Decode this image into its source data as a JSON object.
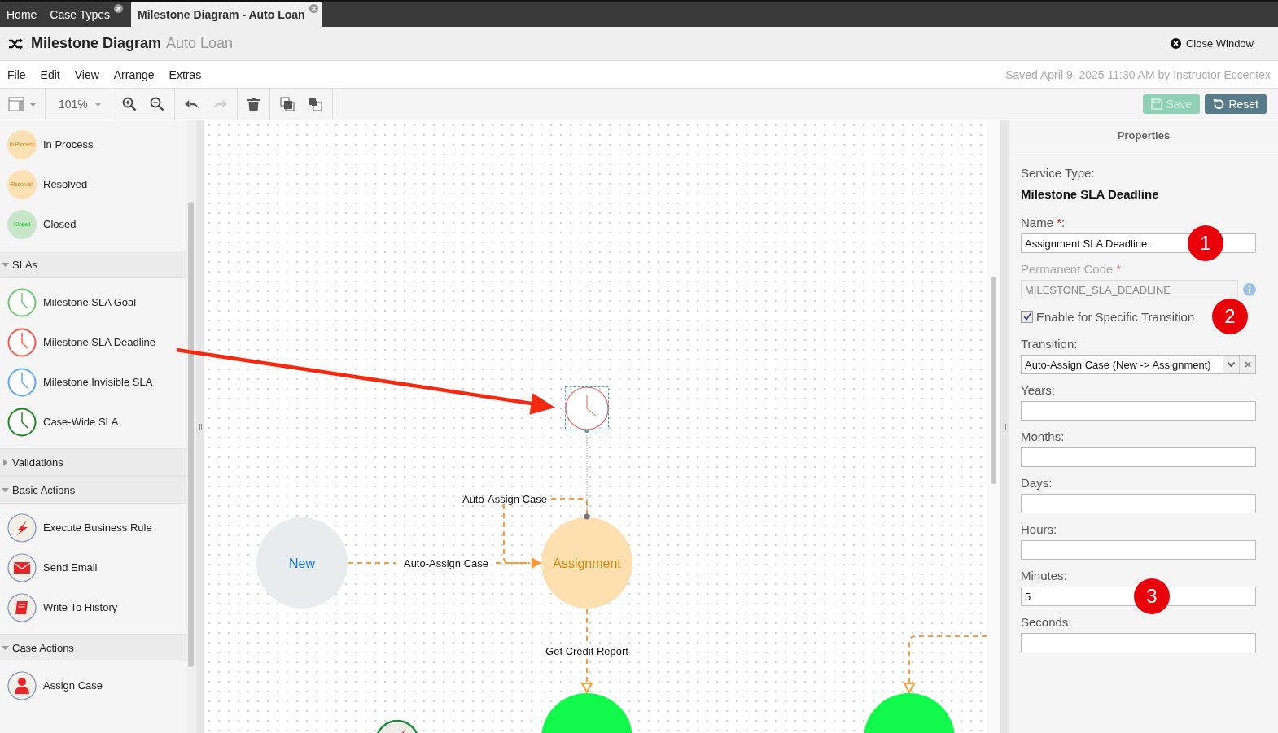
{
  "tabs": [
    {
      "label": "Home",
      "selected": false,
      "closable": false
    },
    {
      "label": "Case Types",
      "selected": false,
      "closable": true
    },
    {
      "label": "Milestone Diagram - Auto Loan",
      "selected": true,
      "closable": true
    }
  ],
  "header": {
    "title": "Milestone Diagram",
    "subtitle": "Auto Loan",
    "close_label": "Close Window"
  },
  "menu": [
    "File",
    "Edit",
    "View",
    "Arrange",
    "Extras"
  ],
  "saved_status": "Saved April 9, 2025 11:30 AM by Instructor Eccentex",
  "toolbar": {
    "zoom": "101%",
    "save": {
      "label": "Save",
      "disabled": true
    },
    "reset": "Reset"
  },
  "palette": [
    {
      "items": [
        {
          "kind": "state",
          "label": "In Process",
          "badge_text": "In Process",
          "color": "#fde0b4"
        },
        {
          "kind": "state",
          "label": "Resolved",
          "badge_text": "Resolved",
          "color": "#fde0b4"
        },
        {
          "kind": "state",
          "label": "Closed",
          "badge_text": "Closed",
          "color": "#c8e6c9"
        }
      ]
    },
    {
      "title": "SLAs",
      "expanded": true,
      "items": [
        {
          "kind": "sla",
          "label": "Milestone SLA Goal",
          "color": "#6cc86c"
        },
        {
          "kind": "sla",
          "label": "Milestone SLA Deadline",
          "color": "#f5594a"
        },
        {
          "kind": "sla",
          "label": "Milestone Invisible SLA",
          "color": "#5aa8f5"
        },
        {
          "kind": "sla",
          "label": "Case-Wide SLA",
          "color": "#1a8a1a"
        }
      ]
    },
    {
      "title": "Validations",
      "expanded": false
    },
    {
      "title": "Basic Actions",
      "expanded": true,
      "items": [
        {
          "kind": "bolt",
          "label": "Execute Business Rule"
        },
        {
          "kind": "mail",
          "label": "Send Email"
        },
        {
          "kind": "book",
          "label": "Write To History"
        }
      ]
    },
    {
      "title": "Case Actions",
      "expanded": true,
      "items": [
        {
          "kind": "person",
          "label": "Assign Case"
        }
      ]
    }
  ],
  "canvas": {
    "sla_selected": true,
    "nodes": [
      {
        "label": "New",
        "color": "#e9ecef"
      },
      {
        "label": "Assignment",
        "color": "#fddfb0"
      },
      {
        "color": "#10f84a"
      },
      {
        "color": "#10f84a"
      }
    ],
    "edge_labels": [
      "Auto-Assign Case",
      "Auto-Assign Case",
      "Get Credit Report"
    ]
  },
  "properties": {
    "title": "Properties",
    "service_type_label": "Service Type:",
    "service_type": "Milestone SLA Deadline",
    "fields": [
      {
        "kind": "text",
        "label": "Name",
        "required_mark": "*",
        "suffix": ":",
        "value": "Assignment SLA Deadline",
        "badge": "1"
      },
      {
        "kind": "text",
        "label": "Permanent Code",
        "required_mark": "*",
        "suffix": ":",
        "disabled": true,
        "value": "MILESTONE_SLA_DEADLINE",
        "info": true
      },
      {
        "kind": "checkbox",
        "label": "Enable for Specific Transition",
        "checked": true,
        "badge": "2"
      },
      {
        "kind": "select",
        "label": "Transition:",
        "value": "Auto-Assign Case (New -> Assignment)"
      },
      {
        "kind": "text",
        "label": "Years:"
      },
      {
        "kind": "text",
        "label": "Months:"
      },
      {
        "kind": "text",
        "label": "Days:"
      },
      {
        "kind": "text",
        "label": "Hours:"
      },
      {
        "kind": "text",
        "label": "Minutes:",
        "value": "5",
        "badge": "3"
      },
      {
        "kind": "text",
        "label": "Seconds:"
      }
    ]
  }
}
